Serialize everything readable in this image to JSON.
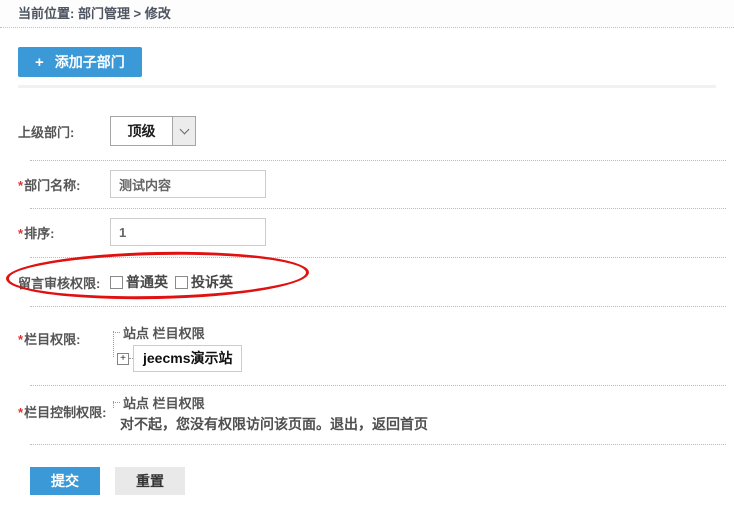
{
  "breadcrumb": {
    "label": "当前位置: 部门管理 > 修改"
  },
  "toolbar": {
    "plus_icon": "+",
    "add_button_label": "添加子部门"
  },
  "form": {
    "parent_dept": {
      "label": "上级部门:",
      "value": "顶级"
    },
    "dept_name": {
      "required": "*",
      "label": "部门名称:",
      "value": "测试内容"
    },
    "sort": {
      "required": "*",
      "label": "排序:",
      "value": "1"
    },
    "msg_audit": {
      "label": "留言审核权限:",
      "options": [
        {
          "label": "普通英",
          "checked": false
        },
        {
          "label": "投诉英",
          "checked": false
        }
      ]
    },
    "column_perm": {
      "required": "*",
      "label": "栏目权限:",
      "tree_root": "站点 栏目权限",
      "expander_icon": "+",
      "node_label": "jeecms演示站"
    },
    "column_ctrl_perm": {
      "required": "*",
      "label": "栏目控制权限:",
      "tree_root": "站点 栏目权限",
      "error_message": "对不起，您没有权限访问该页面。",
      "logout_link": "退出",
      "separator": "，",
      "home_link": "返回首页"
    }
  },
  "actions": {
    "submit_label": "提交",
    "reset_label": "重置"
  },
  "colors": {
    "accent_blue": "#3b99d8",
    "annotation_red": "#e01111",
    "required_red": "#e03131",
    "divider_gray": "#f1f1f1",
    "breadcrumb_dotted_blue": "#a9c9e2"
  }
}
